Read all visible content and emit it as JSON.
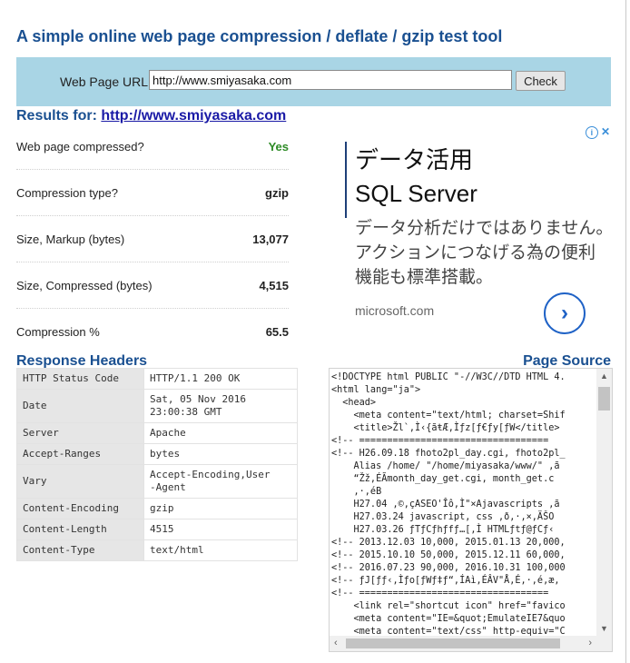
{
  "page": {
    "title": "A simple online web page compression / deflate / gzip test tool"
  },
  "form": {
    "url_label": "Web Page URL:",
    "url_value": "http://www.smiyasaka.com",
    "check_label": "Check"
  },
  "results": {
    "label": "Results for:",
    "url": "http://www.smiyasaka.com",
    "rows": [
      {
        "key": "Web page compressed?",
        "value": "Yes"
      },
      {
        "key": "Compression type?",
        "value": "gzip"
      },
      {
        "key": "Size, Markup (bytes)",
        "value": "13,077"
      },
      {
        "key": "Size, Compressed (bytes)",
        "value": "4,515"
      },
      {
        "key": "Compression %",
        "value": "65.5"
      }
    ]
  },
  "ad": {
    "headline1": "データ活用",
    "headline2": "SQL Server",
    "body_line1": "データ分析だけではありません。",
    "body_line2": "アクションにつなげる為の便利",
    "body_line3": "機能も標準搭載。",
    "domain": "microsoft.com",
    "info_icon": "i",
    "close_icon": "✕",
    "go_icon": "›"
  },
  "response_headers": {
    "title": "Response Headers",
    "rows": [
      {
        "key": "HTTP Status Code",
        "value": "HTTP/1.1 200 OK"
      },
      {
        "key": "Date",
        "value": "Sat, 05 Nov 2016\n23:00:38 GMT"
      },
      {
        "key": "Server",
        "value": "Apache"
      },
      {
        "key": "Accept-Ranges",
        "value": "bytes"
      },
      {
        "key": "Vary",
        "value": "Accept-Encoding,User\n-Agent"
      },
      {
        "key": "Content-Encoding",
        "value": "gzip"
      },
      {
        "key": "Content-Length",
        "value": "4515"
      },
      {
        "key": "Content-Type",
        "value": "text/html"
      }
    ]
  },
  "page_source": {
    "title": "Page Source",
    "lines": [
      "<!DOCTYPE html PUBLIC \"-//W3C//DTD HTML 4.",
      "<html lang=\"ja\">",
      "  <head>",
      "    <meta content=\"text/html; charset=Shif",
      "    <title>Žl`‚Ì‹{ãŧÆ,Ìƒz[ƒ€ƒy[ƒW</title>",
      "<!-- ==================================",
      "<!-- H26.09.18 fhoto2pl_day.cgi, fhoto2pl_",
      "    Alias /home/ \"/home/miyasaka/www/\" ,ã",
      "    “Žž,ÉÃmonth_day_get.cgi, month_get.c",
      "    ,·,éB",
      "    H27.04 ,©,çASEO'Îô,Ì\"×Ajavascripts ,ã",
      "    H27.03.24 javascript, css ,ð,·,×,ÄŠO",
      "    H27.03.26 ƒTƒCƒhƒfƒ…[,Ì HTMLƒtƒ@ƒCƒ‹",
      "<!-- 2013.12.03 10,000, 2015.01.13 20,000,",
      "<!-- 2015.10.10 50,000, 2015.12.11 60,000,",
      "<!-- 2016.07.23 90,000, 2016.10.31 100,000",
      "<!-- ƒJ[ƒƒ‹,Ìƒo[ƒWƒ‡ƒ“,ÍAì,ÉÂV\"Å,É,·,é,æ,",
      "<!-- ==================================",
      "    <link rel=\"shortcut icon\" href=\"favico",
      "    <meta content=\"IE=&quot;EmulateIE7&quo",
      "    <meta content=\"text/css\" http-equiv=\"C"
    ]
  }
}
